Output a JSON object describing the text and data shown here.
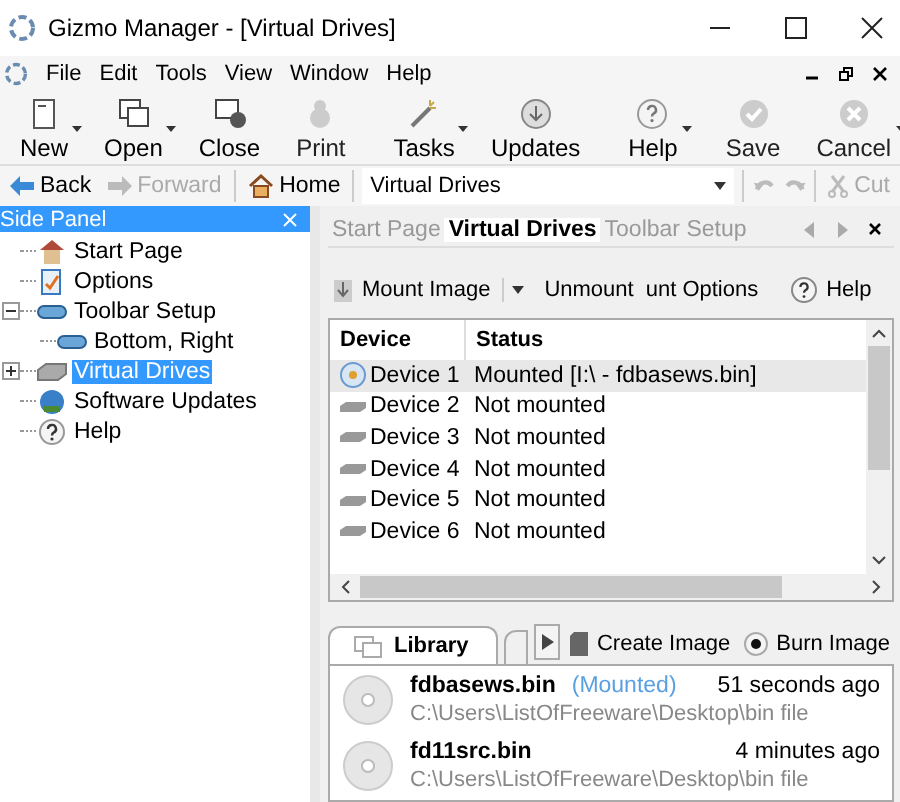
{
  "window": {
    "title": "Gizmo Manager - [Virtual Drives]"
  },
  "menu": [
    "File",
    "Edit",
    "Tools",
    "View",
    "Window",
    "Help"
  ],
  "toolbar": [
    {
      "label": "New",
      "kind": "new",
      "dropdown": true,
      "disabled": false
    },
    {
      "label": "Open",
      "kind": "open",
      "dropdown": true,
      "disabled": false
    },
    {
      "label": "Close",
      "kind": "close",
      "dropdown": false,
      "disabled": false
    },
    {
      "label": "Print",
      "kind": "print",
      "dropdown": false,
      "disabled": true
    },
    {
      "label": "Tasks",
      "kind": "tasks",
      "dropdown": true,
      "disabled": false
    },
    {
      "label": "Updates",
      "kind": "updates",
      "dropdown": false,
      "disabled": false
    },
    {
      "label": "Help",
      "kind": "help",
      "dropdown": true,
      "disabled": false
    },
    {
      "label": "Save",
      "kind": "save",
      "dropdown": false,
      "disabled": true
    },
    {
      "label": "Cancel",
      "kind": "cancel",
      "dropdown": true,
      "disabled": true
    }
  ],
  "nav": {
    "back": {
      "label": "Back",
      "disabled": false
    },
    "forward": {
      "label": "Forward",
      "disabled": true
    },
    "home": "Home",
    "address": "Virtual Drives",
    "cut": {
      "label": "Cut",
      "disabled": true
    }
  },
  "side_panel": {
    "title": "Side Panel",
    "items": [
      {
        "label": "Start Page",
        "selected": false
      },
      {
        "label": "Options",
        "selected": false
      },
      {
        "label": "Toolbar Setup",
        "selected": false,
        "expanded": true,
        "children": [
          {
            "label": "Bottom, Right",
            "selected": false
          }
        ]
      },
      {
        "label": "Virtual Drives",
        "selected": true,
        "expanded": false
      },
      {
        "label": "Software Updates",
        "selected": false
      },
      {
        "label": "Help",
        "selected": false
      }
    ]
  },
  "tabs": [
    {
      "label": "Start Page",
      "selected": false
    },
    {
      "label": "Virtual Drives",
      "selected": true
    },
    {
      "label": "Toolbar Setup",
      "selected": false
    }
  ],
  "actions": [
    {
      "label": "Mount Image",
      "kind": "mount"
    },
    {
      "label": "Unmount",
      "kind": "unmount"
    },
    {
      "label": "unt Options",
      "kind": "options"
    },
    {
      "label": "Help",
      "kind": "help"
    }
  ],
  "table": {
    "columns": [
      "Device",
      "Status"
    ],
    "rows": [
      {
        "device": "Device 1",
        "status": "Mounted [I:\\ - fdbasews.bin]",
        "mounted": true,
        "selected": true
      },
      {
        "device": "Device 2",
        "status": "Not mounted",
        "mounted": false,
        "selected": false
      },
      {
        "device": "Device 3",
        "status": "Not mounted",
        "mounted": false,
        "selected": false
      },
      {
        "device": "Device 4",
        "status": "Not mounted",
        "mounted": false,
        "selected": false
      },
      {
        "device": "Device 5",
        "status": "Not mounted",
        "mounted": false,
        "selected": false
      },
      {
        "device": "Device 6",
        "status": "Not mounted",
        "mounted": false,
        "selected": false
      }
    ]
  },
  "library": {
    "tabs": [
      {
        "label": "Library",
        "selected": true
      }
    ],
    "actions": [
      {
        "label": "Create Image",
        "kind": "create"
      },
      {
        "label": "Burn Image",
        "kind": "burn"
      }
    ],
    "files": [
      {
        "name": "fdbasews.bin",
        "tag": "(Mounted)",
        "time": "51 seconds ago",
        "path": "C:\\Users\\ListOfFreeware\\Desktop\\bin file"
      },
      {
        "name": "fd11src.bin",
        "time": "4 minutes ago",
        "path": "C:\\Users\\ListOfFreeware\\Desktop\\bin file"
      }
    ]
  }
}
